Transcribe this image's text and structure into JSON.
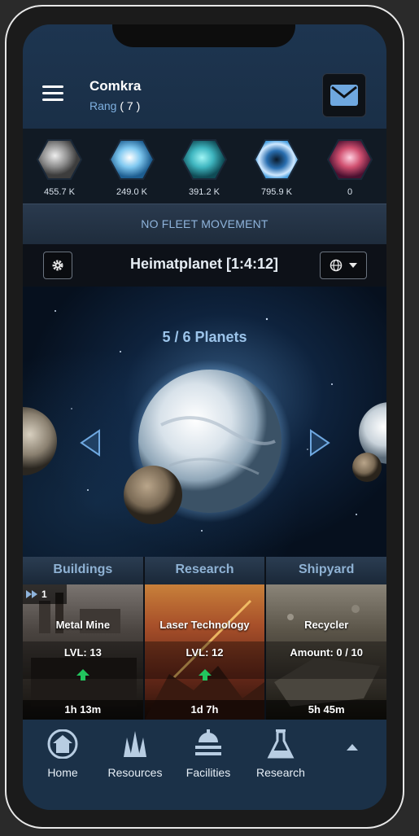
{
  "player": {
    "name": "Comkra",
    "rank_label": "Rang",
    "rank_value": "( 7 )"
  },
  "resources": [
    {
      "icon": "metal-icon",
      "value": "455.7 K",
      "color": "#9a9a9a"
    },
    {
      "icon": "crystal-icon",
      "value": "249.0 K",
      "color": "#7fc8f0"
    },
    {
      "icon": "deuterium-icon",
      "value": "391.2 K",
      "color": "#3fb6c0"
    },
    {
      "icon": "energy-icon",
      "value": "795.9 K",
      "color": "#4aa0e0"
    },
    {
      "icon": "dark-matter-icon",
      "value": "0",
      "color": "#d05070"
    }
  ],
  "fleet": {
    "status": "NO FLEET MOVEMENT"
  },
  "planet": {
    "name": "Heimatplanet [1:4:12]",
    "count_text": "5 / 6 Planets"
  },
  "tabs": [
    "Buildings",
    "Research",
    "Shipyard"
  ],
  "cards": [
    {
      "title": "Metal Mine",
      "info": "LVL: 13",
      "time": "1h 13m",
      "queue": "1"
    },
    {
      "title": "Laser Technology",
      "info": "LVL: 12",
      "time": "1d 7h"
    },
    {
      "title": "Recycler",
      "info": "Amount: 0 / 10",
      "time": "5h 45m"
    }
  ],
  "nav": [
    {
      "icon": "home-icon",
      "label": "Home"
    },
    {
      "icon": "resources-icon",
      "label": "Resources"
    },
    {
      "icon": "facilities-icon",
      "label": "Facilities"
    },
    {
      "icon": "research-icon",
      "label": "Research"
    }
  ],
  "colors": {
    "accent": "#8fb4dc",
    "upgrade": "#22c55e",
    "nav_bg": "#1b3148"
  }
}
